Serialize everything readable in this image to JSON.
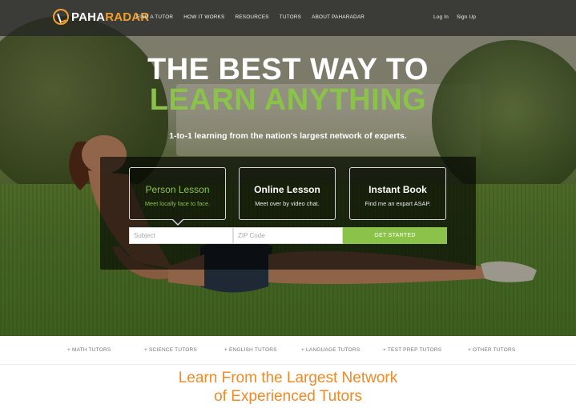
{
  "brand": {
    "name_a": "PAHA",
    "name_b": "RADAR"
  },
  "nav": {
    "links": [
      "FIND A TUTOR",
      "HOW IT WORKS",
      "RESOURCES",
      "TUTORS",
      "ABOUT PAHARADAR"
    ],
    "login": "Log In",
    "signup": "Sign Up"
  },
  "hero": {
    "title_line1": "THE BEST WAY TO",
    "title_line2": "LEARN ANYTHING",
    "subtitle": "1-to-1 learning from the nation's largest network of experts."
  },
  "lesson_types": [
    {
      "title": "Person Lesson",
      "subtitle": "Meet locally face to face."
    },
    {
      "title": "Online Lesson",
      "subtitle": "Meet over by video chat."
    },
    {
      "title": "Instant Book",
      "subtitle": "Find me an expart ASAP."
    }
  ],
  "search": {
    "subject_placeholder": "Subject",
    "zip_placeholder": "ZIP Code",
    "button": "GET STARTED"
  },
  "subject_links": [
    "+ MATH TUTORS",
    "+ SCIENCE TUTORS",
    "+ ENGLISH TUTORS",
    "+ LANGUAGE TUTORS",
    "+ TEST PREP TUTORS",
    "+ OTHER TUTORS"
  ],
  "section": {
    "title_line1": "Learn From the Largest Network",
    "title_line2": "of Experienced Tutors"
  },
  "colors": {
    "accent_green": "#8bc34a",
    "accent_orange": "#ef8a27",
    "logo_orange": "#f0a030"
  }
}
